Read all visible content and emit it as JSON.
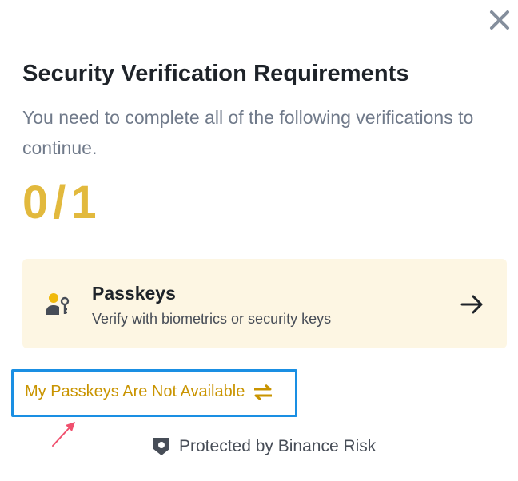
{
  "dialog": {
    "close_icon": "close-icon",
    "title": "Security Verification Requirements",
    "subtitle": "You need to complete all of the following verifications to continue.",
    "progress": "0/1"
  },
  "method": {
    "icon": "passkey-user-key-icon",
    "name": "Passkeys",
    "description": "Verify with biometrics or security keys",
    "arrow_icon": "arrow-right-icon"
  },
  "alternative": {
    "label": "My Passkeys Are Not Available",
    "icon": "swap-icon"
  },
  "footer": {
    "icon": "shield-icon",
    "text": "Protected by Binance Risk"
  },
  "colors": {
    "accent_yellow": "#e2b93d",
    "link_gold": "#c99400",
    "card_background": "#fdf6e3",
    "highlight_border": "#1a8fe3",
    "annotation_arrow": "#f0506e"
  }
}
